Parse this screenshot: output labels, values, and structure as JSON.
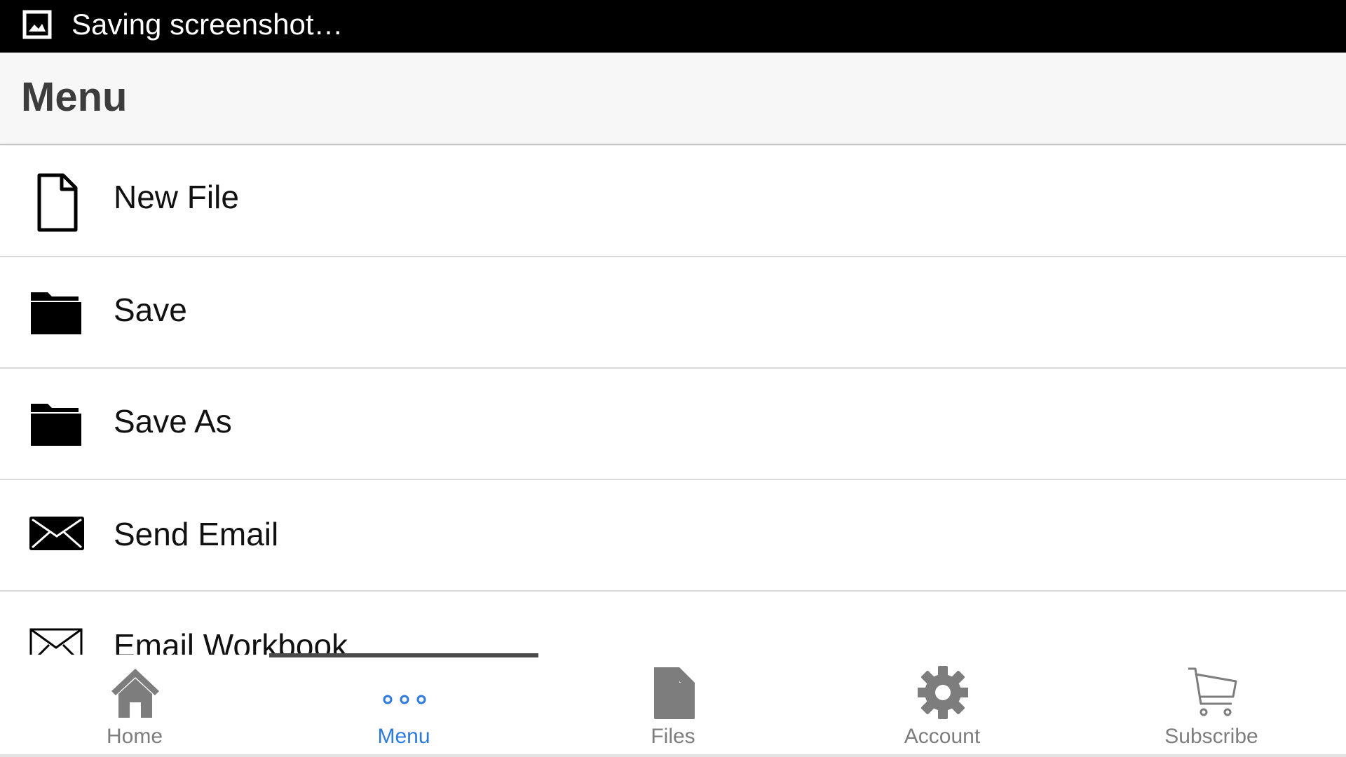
{
  "status_bar": {
    "text": "Saving screenshot…",
    "icon": "image-icon"
  },
  "header": {
    "title": "Menu"
  },
  "menu": {
    "items": [
      {
        "label": "New File",
        "icon": "new-file-icon"
      },
      {
        "label": "Save",
        "icon": "folder-icon"
      },
      {
        "label": "Save As",
        "icon": "folder-icon"
      },
      {
        "label": "Send Email",
        "icon": "envelope-icon"
      },
      {
        "label": "Email Workbook",
        "icon": "envelope-outline-icon"
      }
    ]
  },
  "tabs": {
    "active": "Menu",
    "active_color": "#2d7be0",
    "inactive_color": "#7d7d7d",
    "items": [
      {
        "label": "Home",
        "icon": "home-icon"
      },
      {
        "label": "Menu",
        "icon": "more-dots-icon"
      },
      {
        "label": "Files",
        "icon": "file-icon"
      },
      {
        "label": "Account",
        "icon": "gear-icon"
      },
      {
        "label": "Subscribe",
        "icon": "cart-icon"
      }
    ]
  }
}
